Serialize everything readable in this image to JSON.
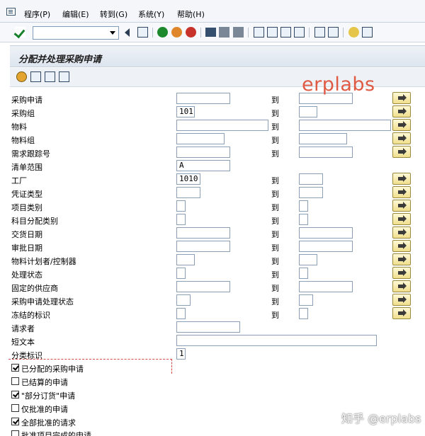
{
  "menu": {
    "items": [
      "程序(P)",
      "编辑(E)",
      "转到(G)",
      "系统(Y)",
      "帮助(H)"
    ]
  },
  "toolbar": {
    "command_field": ""
  },
  "screen": {
    "title": "分配并处理采购申请"
  },
  "rows": [
    {
      "label": "采购申请",
      "from": "",
      "to": ""
    },
    {
      "label": "采购组",
      "from": "101",
      "to": ""
    },
    {
      "label": "物料",
      "from": "",
      "to": ""
    },
    {
      "label": "物料组",
      "from": "",
      "to": ""
    },
    {
      "label": "需求跟踪号",
      "from": "",
      "to": ""
    },
    {
      "label": "清单范围",
      "from": "A"
    },
    {
      "label": "工厂",
      "from": "1010",
      "to": ""
    },
    {
      "label": "凭证类型",
      "from": "",
      "to": ""
    },
    {
      "label": "项目类别",
      "from": "",
      "to": ""
    },
    {
      "label": "科目分配类别",
      "from": "",
      "to": ""
    },
    {
      "label": "交货日期",
      "from": "",
      "to": ""
    },
    {
      "label": "审批日期",
      "from": "",
      "to": ""
    },
    {
      "label": "物料计划者/控制器",
      "from": "",
      "to": ""
    },
    {
      "label": "处理状态",
      "from": "",
      "to": ""
    },
    {
      "label": "固定的供应商",
      "from": "",
      "to": ""
    },
    {
      "label": "采购申请处理状态",
      "from": "",
      "to": ""
    },
    {
      "label": "冻结的标识",
      "from": "",
      "to": ""
    },
    {
      "label": "请求者",
      "from": ""
    },
    {
      "label": "短文本",
      "from": ""
    },
    {
      "label": "分类标识",
      "from": "1"
    }
  ],
  "to_label": "到",
  "checkboxes": [
    {
      "label": "已分配的采购申请",
      "checked": true
    },
    {
      "label": "已结算的申请",
      "checked": false
    },
    {
      "label": "\"部分订货\"申请",
      "checked": true
    },
    {
      "label": "仅批准的申请",
      "checked": false
    },
    {
      "label": "全部批准的请求",
      "checked": true
    },
    {
      "label": "批准项目完成的申请",
      "checked": false
    }
  ],
  "watermarks": {
    "top": "erplabs",
    "bottom": "知乎 @erplabs"
  }
}
